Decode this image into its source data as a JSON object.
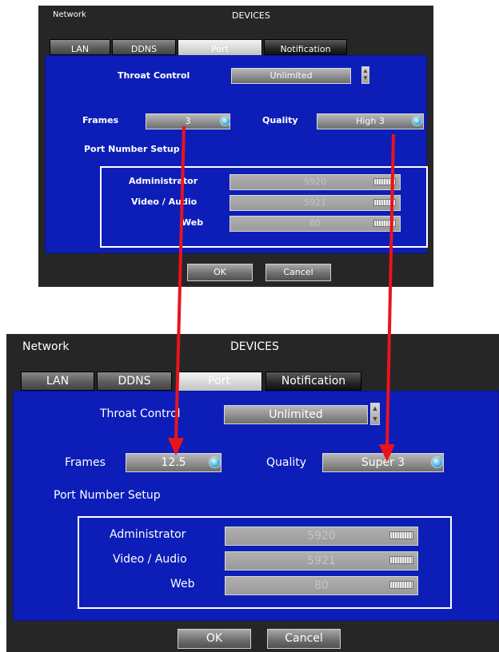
{
  "top_dialog": {
    "title_left": "Network",
    "title_center": "DEVICES",
    "tabs": [
      {
        "label": "LAN"
      },
      {
        "label": "DDNS"
      },
      {
        "label": "Port"
      },
      {
        "label": "Notification"
      }
    ],
    "throat_control": {
      "label": "Throat Control",
      "value": "Unlimited"
    },
    "frames": {
      "label": "Frames",
      "value": "3"
    },
    "quality": {
      "label": "Quality",
      "value": "High 3"
    },
    "port_setup": {
      "title": "Port Number Setup",
      "rows": [
        {
          "label": "Administrator",
          "value": "5920"
        },
        {
          "label": "Video / Audio",
          "value": "5921"
        },
        {
          "label": "Web",
          "value": "80"
        }
      ]
    },
    "ok_label": "OK",
    "cancel_label": "Cancel"
  },
  "bottom_dialog": {
    "title_left": "Network",
    "title_center": "DEVICES",
    "tabs": [
      {
        "label": "LAN"
      },
      {
        "label": "DDNS"
      },
      {
        "label": "Port"
      },
      {
        "label": "Notification"
      }
    ],
    "throat_control": {
      "label": "Throat Control",
      "value": "Unlimited"
    },
    "frames": {
      "label": "Frames",
      "value": "12.5"
    },
    "quality": {
      "label": "Quality",
      "value": "Super 3"
    },
    "port_setup": {
      "title": "Port Number Setup",
      "rows": [
        {
          "label": "Administrator",
          "value": "5920"
        },
        {
          "label": "Video / Audio",
          "value": "5921"
        },
        {
          "label": "Web",
          "value": "80"
        }
      ]
    },
    "ok_label": "OK",
    "cancel_label": "Cancel"
  },
  "colors": {
    "panel_blue": "#0d1eb8",
    "dialog_dark": "#262626",
    "arrow_red": "#e8141c"
  },
  "icons": [
    "spin-up-down-icon",
    "globe-icon",
    "keyboard-icon",
    "arrow-icon"
  ]
}
